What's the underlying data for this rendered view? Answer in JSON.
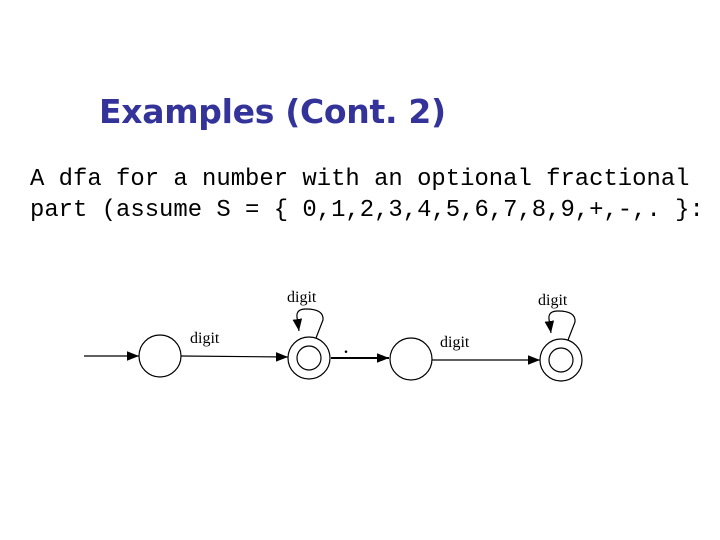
{
  "slide": {
    "title": "Examples (Cont. 2)",
    "description_lines": [
      "A dfa for a number with an optional fractional",
      "part (assume S = { 0,1,2,3,4,5,6,7,8,9,+,-,. }:"
    ]
  },
  "diagram": {
    "type": "dfa",
    "states": [
      {
        "id": "q0",
        "start": true,
        "accepting": false
      },
      {
        "id": "q1",
        "start": false,
        "accepting": true
      },
      {
        "id": "q2",
        "start": false,
        "accepting": false
      },
      {
        "id": "q3",
        "start": false,
        "accepting": true
      }
    ],
    "transitions": [
      {
        "from": "q0",
        "to": "q1",
        "label": "digit"
      },
      {
        "from": "q1",
        "to": "q1",
        "label": "digit"
      },
      {
        "from": "q1",
        "to": "q2",
        "label": "."
      },
      {
        "from": "q2",
        "to": "q3",
        "label": "digit"
      },
      {
        "from": "q3",
        "to": "q3",
        "label": "digit"
      }
    ]
  }
}
